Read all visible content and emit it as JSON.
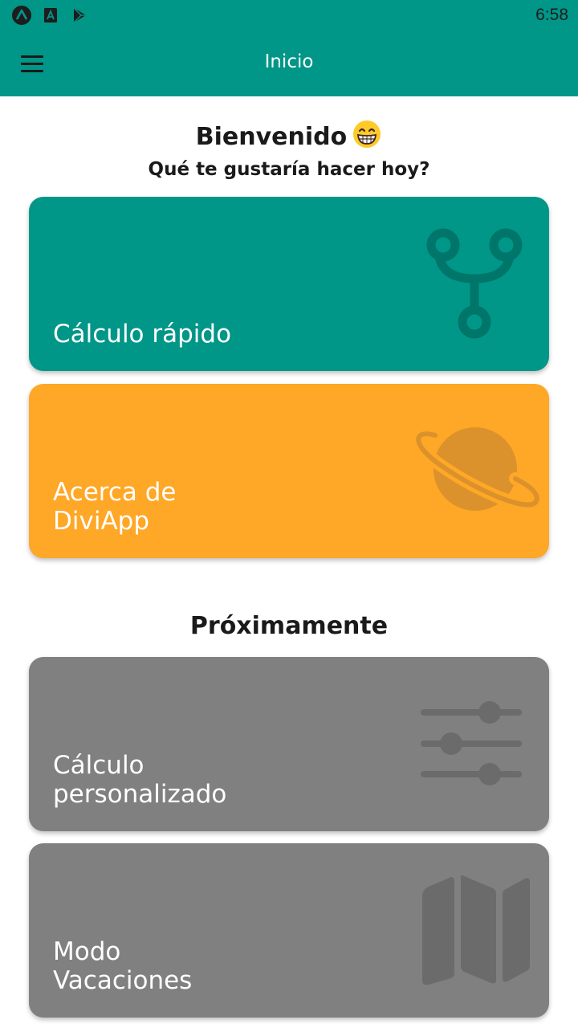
{
  "status_bar": {
    "time": "6:58",
    "icons": [
      "a-circle-icon",
      "a-square-icon",
      "play-store-icon"
    ]
  },
  "app_bar": {
    "title": "Inicio",
    "menu_icon": "hamburger-menu-icon",
    "color": "#009688"
  },
  "welcome": {
    "title": "Bienvenido",
    "emoji": "grinning-face-emoji",
    "subtitle": "Qué te gustaría hacer hoy?"
  },
  "cards": [
    {
      "label": "Cálculo rápido",
      "icon": "fork-icon",
      "color": "#009688"
    },
    {
      "label": "Acerca de\nDiviApp",
      "icon": "planet-icon",
      "color": "#FFA726"
    }
  ],
  "upcoming": {
    "title": "Próximamente",
    "cards": [
      {
        "label": "Cálculo\npersonalizado",
        "icon": "sliders-icon",
        "color": "#808080"
      },
      {
        "label": "Modo\nVacaciones",
        "icon": "map-icon",
        "color": "#808080"
      }
    ]
  }
}
